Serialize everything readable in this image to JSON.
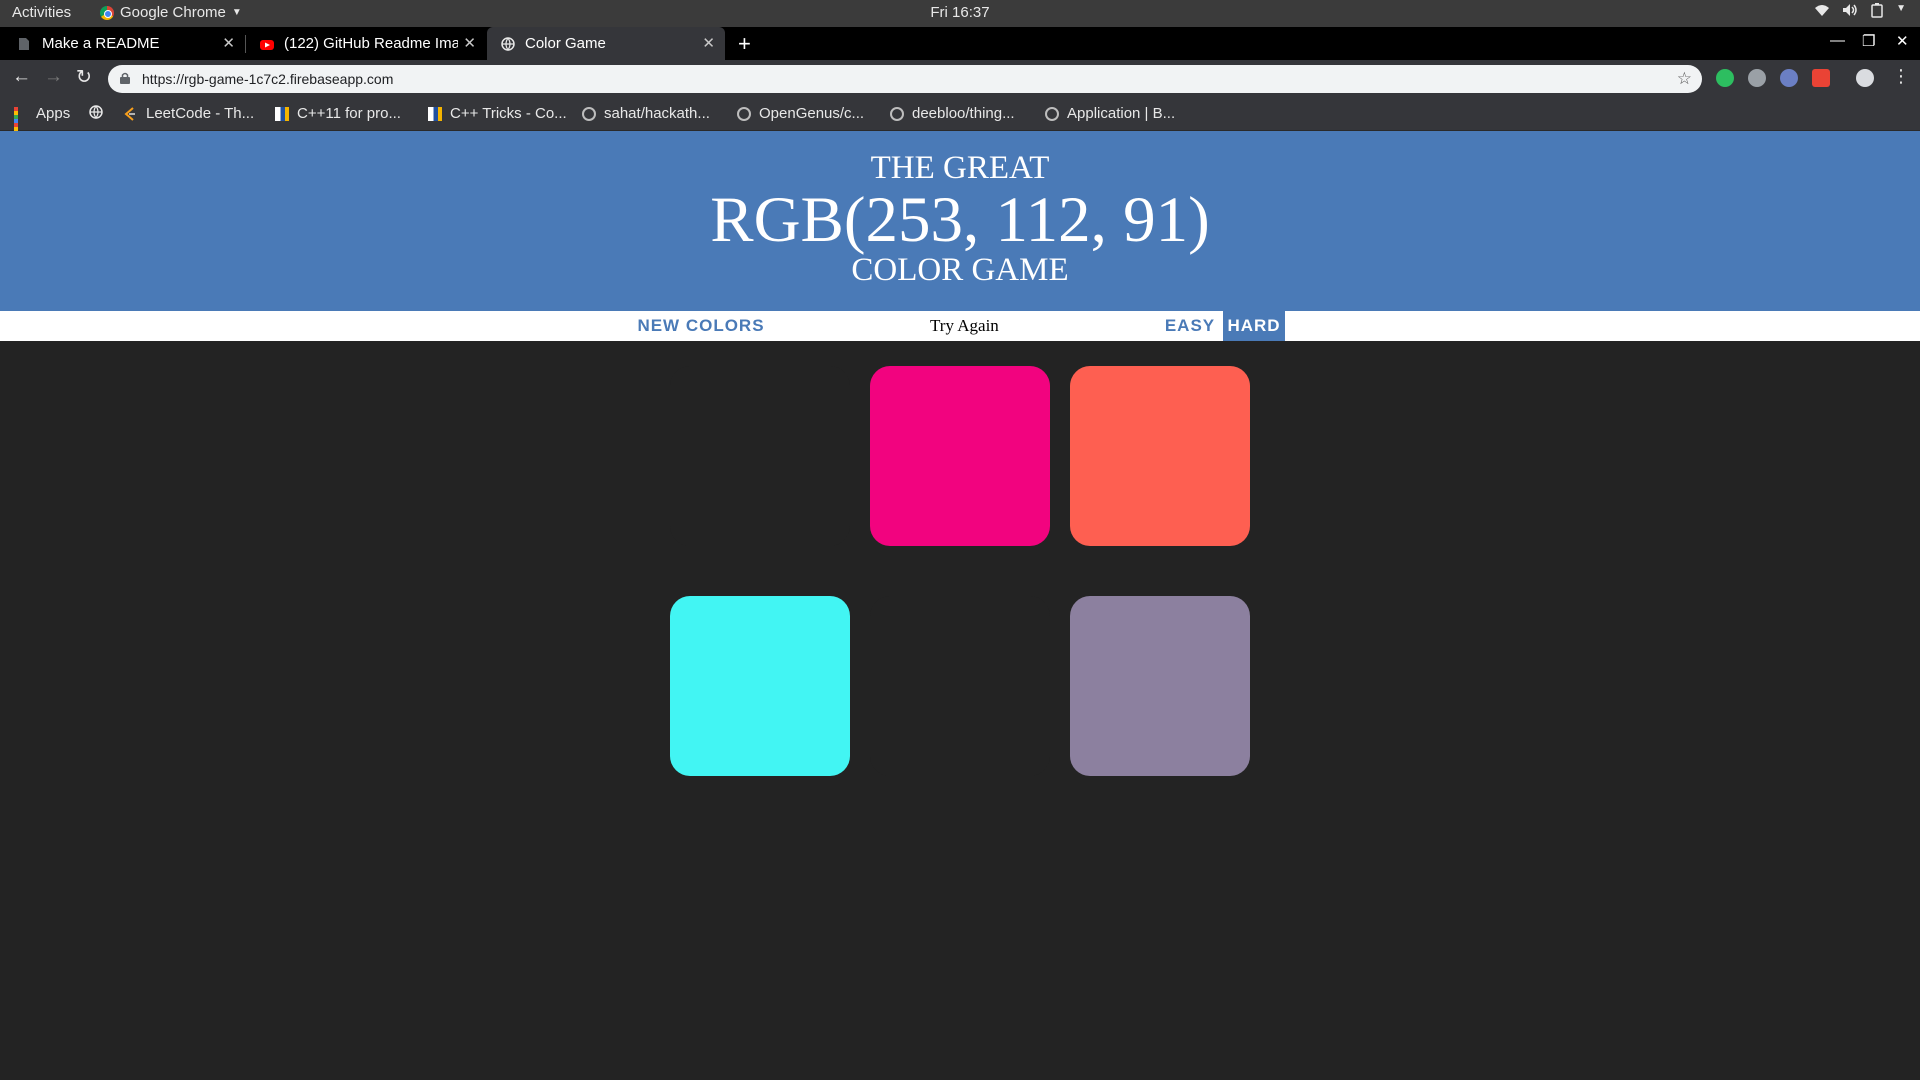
{
  "desktop": {
    "activities": "Activities",
    "app_name": "Google Chrome",
    "clock": "Fri 16:37"
  },
  "tabs": [
    {
      "title": "Make a README",
      "favicon": "document-icon",
      "active": false
    },
    {
      "title": "(122) GitHub Readme Ima",
      "favicon": "youtube-icon",
      "active": false
    },
    {
      "title": "Color Game",
      "favicon": "globe-icon",
      "active": true
    }
  ],
  "address_bar": {
    "url": "https://rgb-game-1c7c2.firebaseapp.com"
  },
  "bookmarks": [
    {
      "label": "Apps",
      "icon": "apps-grid-icon"
    },
    {
      "label": "",
      "icon": "globe-icon"
    },
    {
      "label": "LeetCode - Th...",
      "icon": "leetcode-icon"
    },
    {
      "label": "C++11 for pro...",
      "icon": "site-icon"
    },
    {
      "label": "C++ Tricks - Co...",
      "icon": "site-icon"
    },
    {
      "label": "sahat/hackath...",
      "icon": "github-icon"
    },
    {
      "label": "OpenGenus/c...",
      "icon": "github-icon"
    },
    {
      "label": "deebloo/thing...",
      "icon": "github-icon"
    },
    {
      "label": "Application | B...",
      "icon": "github-icon"
    }
  ],
  "game": {
    "header": {
      "line1": "THE GREAT",
      "target_color": "RGB(253, 112, 91)",
      "line3": "COLOR GAME",
      "background": "#4a7ab7"
    },
    "controls": {
      "new_colors": "NEW COLORS",
      "message": "Try Again",
      "easy": "EASY",
      "hard": "HARD",
      "selected_mode": "HARD"
    },
    "squares": [
      {
        "color": "#232323",
        "visible": false
      },
      {
        "color": "#f2037f",
        "visible": true
      },
      {
        "color": "#fe5f51",
        "visible": true
      },
      {
        "color": "#42f5f3",
        "visible": true
      },
      {
        "color": "#232323",
        "visible": false
      },
      {
        "color": "#8c809f",
        "visible": true
      }
    ]
  }
}
